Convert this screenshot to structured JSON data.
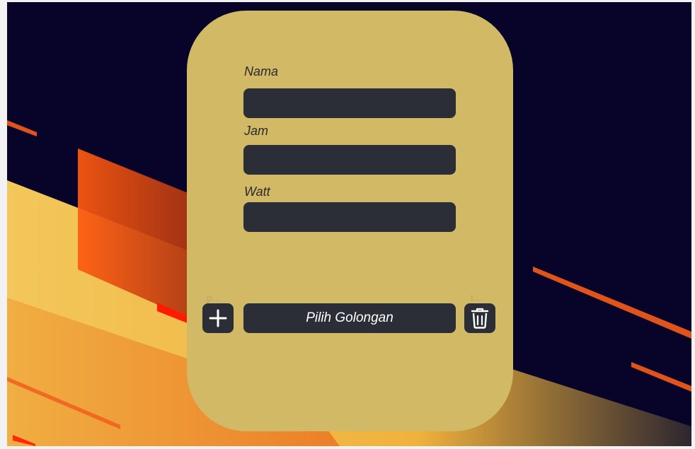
{
  "form": {
    "fields": [
      {
        "label": "Nama",
        "value": ""
      },
      {
        "label": "Jam",
        "value": ""
      },
      {
        "label": "Watt",
        "value": ""
      }
    ],
    "select_label": "Pilih Golongan",
    "add_hint": "p...",
    "delete_hint": "t..."
  },
  "icons": {
    "add": "plus-icon",
    "delete": "trash-icon"
  },
  "colors": {
    "background": "#080429",
    "card": "#d1b966",
    "input": "#2b2d37",
    "accent_orange": "#f05a1c",
    "accent_yellow": "#f2c75a"
  }
}
